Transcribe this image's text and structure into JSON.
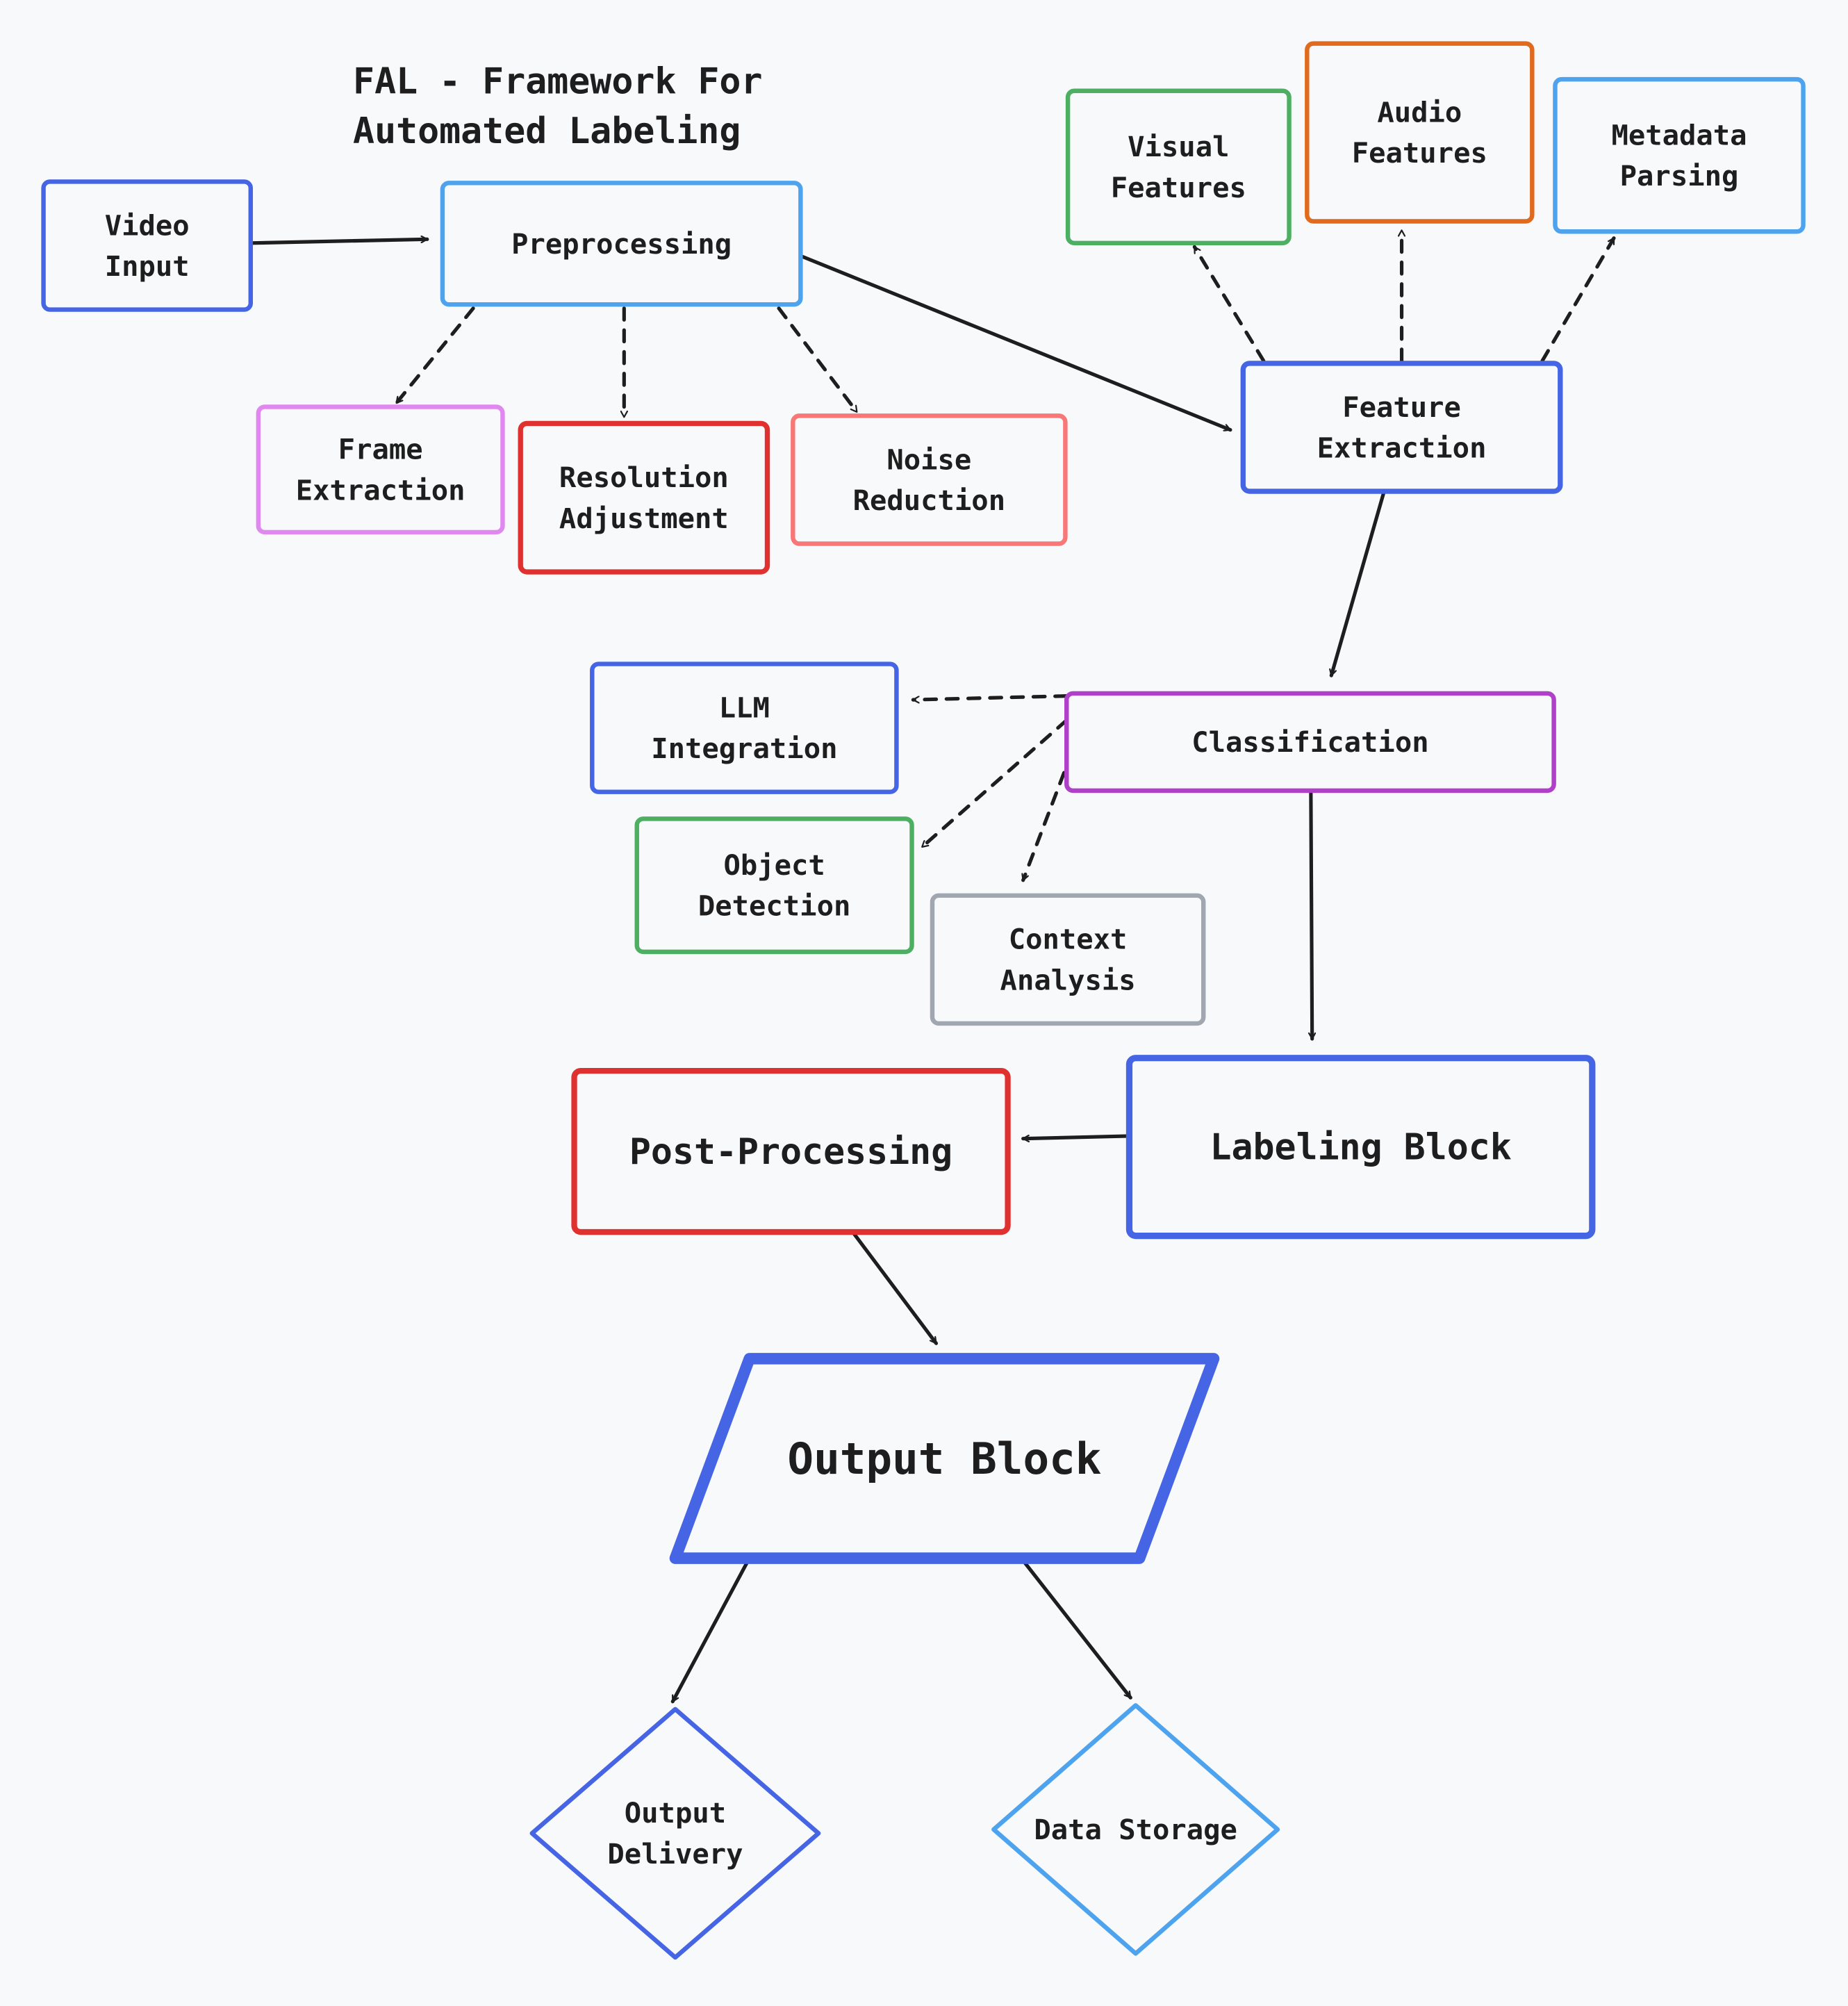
{
  "title": {
    "lines": [
      "FAL - Framework For",
      "Automated Labeling"
    ]
  },
  "colors": {
    "background": "#f8f9fb",
    "text": "#1e1e1e",
    "edge": "#1e1e1e",
    "royal_blue": "#4565e5",
    "sky_blue": "#4ea3ef",
    "violet": "#e088f0",
    "red": "#e03131",
    "salmon": "#f87878",
    "green": "#4caf62",
    "orange": "#e06b1e",
    "purple": "#b03fca",
    "gray": "#a0a7b1"
  },
  "nodes": [
    {
      "id": "video-input",
      "lines": [
        "Video",
        "Input"
      ],
      "shape": "rect",
      "color": "royal_blue"
    },
    {
      "id": "preprocessing",
      "lines": [
        "Preprocessing"
      ],
      "shape": "rect",
      "color": "sky_blue"
    },
    {
      "id": "frame-extraction",
      "lines": [
        "Frame",
        "Extraction"
      ],
      "shape": "rect",
      "color": "violet"
    },
    {
      "id": "resolution-adjustment",
      "lines": [
        "Resolution",
        "Adjustment"
      ],
      "shape": "rect",
      "color": "red"
    },
    {
      "id": "noise-reduction",
      "lines": [
        "Noise",
        "Reduction"
      ],
      "shape": "rect",
      "color": "salmon"
    },
    {
      "id": "visual-features",
      "lines": [
        "Visual",
        "Features"
      ],
      "shape": "rect",
      "color": "green"
    },
    {
      "id": "audio-features",
      "lines": [
        "Audio",
        "Features"
      ],
      "shape": "rect",
      "color": "orange"
    },
    {
      "id": "metadata-parsing",
      "lines": [
        "Metadata",
        "Parsing"
      ],
      "shape": "rect",
      "color": "sky_blue"
    },
    {
      "id": "feature-extraction",
      "lines": [
        "Feature",
        "Extraction"
      ],
      "shape": "rect",
      "color": "royal_blue"
    },
    {
      "id": "classification",
      "lines": [
        "Classification"
      ],
      "shape": "rect",
      "color": "purple"
    },
    {
      "id": "llm-integration",
      "lines": [
        "LLM",
        "Integration"
      ],
      "shape": "rect",
      "color": "royal_blue"
    },
    {
      "id": "object-detection",
      "lines": [
        "Object",
        "Detection"
      ],
      "shape": "rect",
      "color": "green"
    },
    {
      "id": "context-analysis",
      "lines": [
        "Context",
        "Analysis"
      ],
      "shape": "rect",
      "color": "gray"
    },
    {
      "id": "labeling-block",
      "lines": [
        "Labeling Block"
      ],
      "shape": "rect",
      "color": "royal_blue"
    },
    {
      "id": "post-processing",
      "lines": [
        "Post-Processing"
      ],
      "shape": "rect",
      "color": "red"
    },
    {
      "id": "output-block",
      "lines": [
        "Output Block"
      ],
      "shape": "parallelogram",
      "color": "royal_blue"
    },
    {
      "id": "output-delivery",
      "lines": [
        "Output",
        "Delivery"
      ],
      "shape": "diamond",
      "color": "royal_blue"
    },
    {
      "id": "data-storage",
      "lines": [
        "Data Storage"
      ],
      "shape": "diamond",
      "color": "sky_blue"
    }
  ],
  "edges": [
    {
      "from": "video-input",
      "to": "preprocessing",
      "style": "solid"
    },
    {
      "from": "preprocessing",
      "to": "frame-extraction",
      "style": "dashed"
    },
    {
      "from": "preprocessing",
      "to": "resolution-adjustment",
      "style": "dashed"
    },
    {
      "from": "preprocessing",
      "to": "noise-reduction",
      "style": "dashed"
    },
    {
      "from": "preprocessing",
      "to": "feature-extraction",
      "style": "solid"
    },
    {
      "from": "feature-extraction",
      "to": "visual-features",
      "style": "dashed"
    },
    {
      "from": "feature-extraction",
      "to": "audio-features",
      "style": "dashed"
    },
    {
      "from": "feature-extraction",
      "to": "metadata-parsing",
      "style": "dashed"
    },
    {
      "from": "feature-extraction",
      "to": "classification",
      "style": "solid"
    },
    {
      "from": "classification",
      "to": "llm-integration",
      "style": "dashed"
    },
    {
      "from": "classification",
      "to": "object-detection",
      "style": "dashed"
    },
    {
      "from": "classification",
      "to": "context-analysis",
      "style": "dashed"
    },
    {
      "from": "classification",
      "to": "labeling-block",
      "style": "solid"
    },
    {
      "from": "labeling-block",
      "to": "post-processing",
      "style": "solid"
    },
    {
      "from": "post-processing",
      "to": "output-block",
      "style": "solid"
    },
    {
      "from": "output-block",
      "to": "output-delivery",
      "style": "solid"
    },
    {
      "from": "output-block",
      "to": "data-storage",
      "style": "solid"
    }
  ]
}
